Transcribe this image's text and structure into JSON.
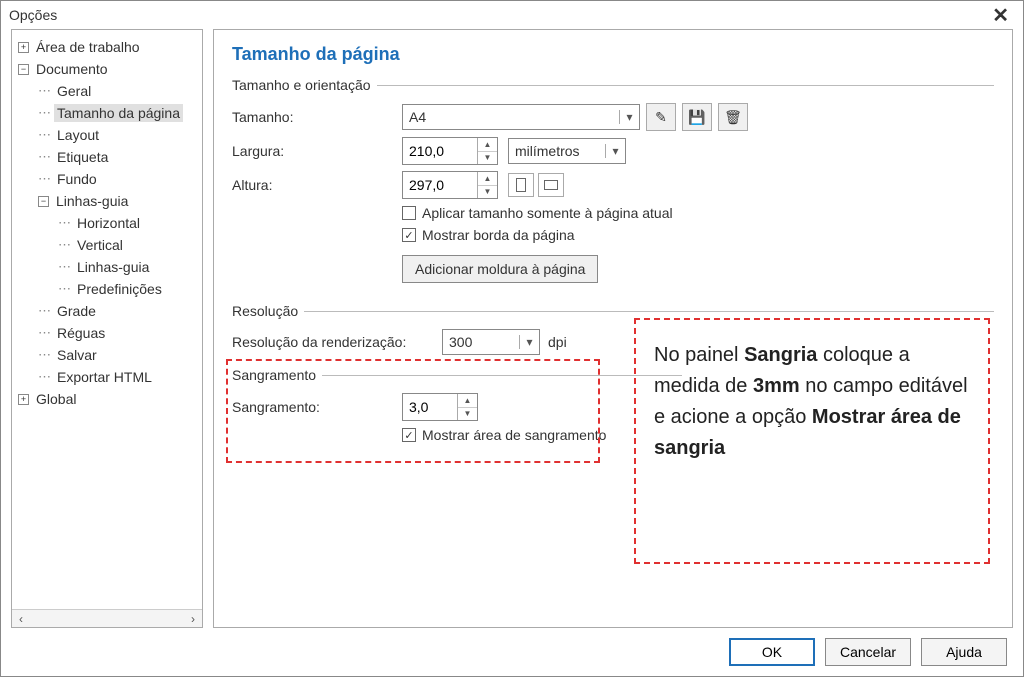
{
  "window": {
    "title": "Opções"
  },
  "tree": {
    "area_trabalho": "Área de trabalho",
    "documento": "Documento",
    "geral": "Geral",
    "tamanho_pagina": "Tamanho da página",
    "layout": "Layout",
    "etiqueta": "Etiqueta",
    "fundo": "Fundo",
    "linhas_guia": "Linhas-guia",
    "horizontal": "Horizontal",
    "vertical": "Vertical",
    "linhas_guia2": "Linhas-guia",
    "predefinicoes": "Predefinições",
    "grade": "Grade",
    "reguas": "Réguas",
    "salvar": "Salvar",
    "exportar_html": "Exportar HTML",
    "global": "Global"
  },
  "main": {
    "title": "Tamanho da página",
    "group_tam_orient": "Tamanho e orientação",
    "label_tamanho": "Tamanho:",
    "value_tamanho": "A4",
    "label_largura": "Largura:",
    "value_largura": "210,0",
    "unit_largura": "milímetros",
    "label_altura": "Altura:",
    "value_altura": "297,0",
    "cb_aplicar": "Aplicar tamanho somente à página atual",
    "cb_mostrar_borda": "Mostrar borda da página",
    "btn_add_moldura": "Adicionar moldura à página",
    "group_resolucao": "Resolução",
    "label_res_render": "Resolução da renderização:",
    "value_res": "300",
    "unit_dpi": "dpi",
    "group_sangramento": "Sangramento",
    "label_sangramento": "Sangramento:",
    "value_sangramento": "3,0",
    "cb_mostrar_sangramento": "Mostrar área de sangramento"
  },
  "annotation": {
    "t1": "No painel ",
    "b1": "Sangria",
    "t2": " coloque a medida de ",
    "b2": "3mm",
    "t3": " no campo editável e acione a opção ",
    "b3": "Mostrar área de sangria"
  },
  "buttons": {
    "ok": "OK",
    "cancel": "Cancelar",
    "help": "Ajuda"
  }
}
